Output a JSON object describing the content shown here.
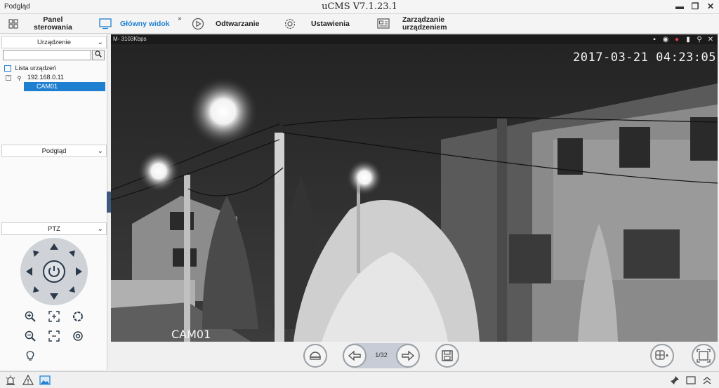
{
  "window": {
    "left_label": "Podgląd",
    "title": "uCMS V7.1.23.1",
    "minimize": "▬",
    "restore": "❐",
    "close": "✕"
  },
  "nav": {
    "items": [
      {
        "label_line1": "Panel",
        "label_line2": "sterowania",
        "icon": "grid-icon"
      },
      {
        "label_line1": "Główny widok",
        "label_line2": "",
        "icon": "monitor-icon",
        "active": true,
        "close": "×"
      },
      {
        "label_line1": "Odtwarzanie",
        "label_line2": "",
        "icon": "play-icon"
      },
      {
        "label_line1": "Ustawienia",
        "label_line2": "",
        "icon": "gear-icon"
      },
      {
        "label_line1": "Zarządzanie",
        "label_line2": "urządzeniem",
        "icon": "device-manage-icon"
      }
    ]
  },
  "left": {
    "device_section": "Urządzenie",
    "search_value": "",
    "tree": {
      "root": "Lista urządzeń",
      "device": "192.168.0.11",
      "camera": "CAM01"
    },
    "preview_section": "Podgląd",
    "ptz_section": "PTZ"
  },
  "video": {
    "bitrate": "M- 3103Kbps",
    "timestamp": "2017-03-21 04:23:05",
    "camera_label": "CAM01"
  },
  "controls": {
    "page": "1/32"
  },
  "colors": {
    "accent": "#1e7fd1",
    "selection": "#1e7fd1"
  }
}
